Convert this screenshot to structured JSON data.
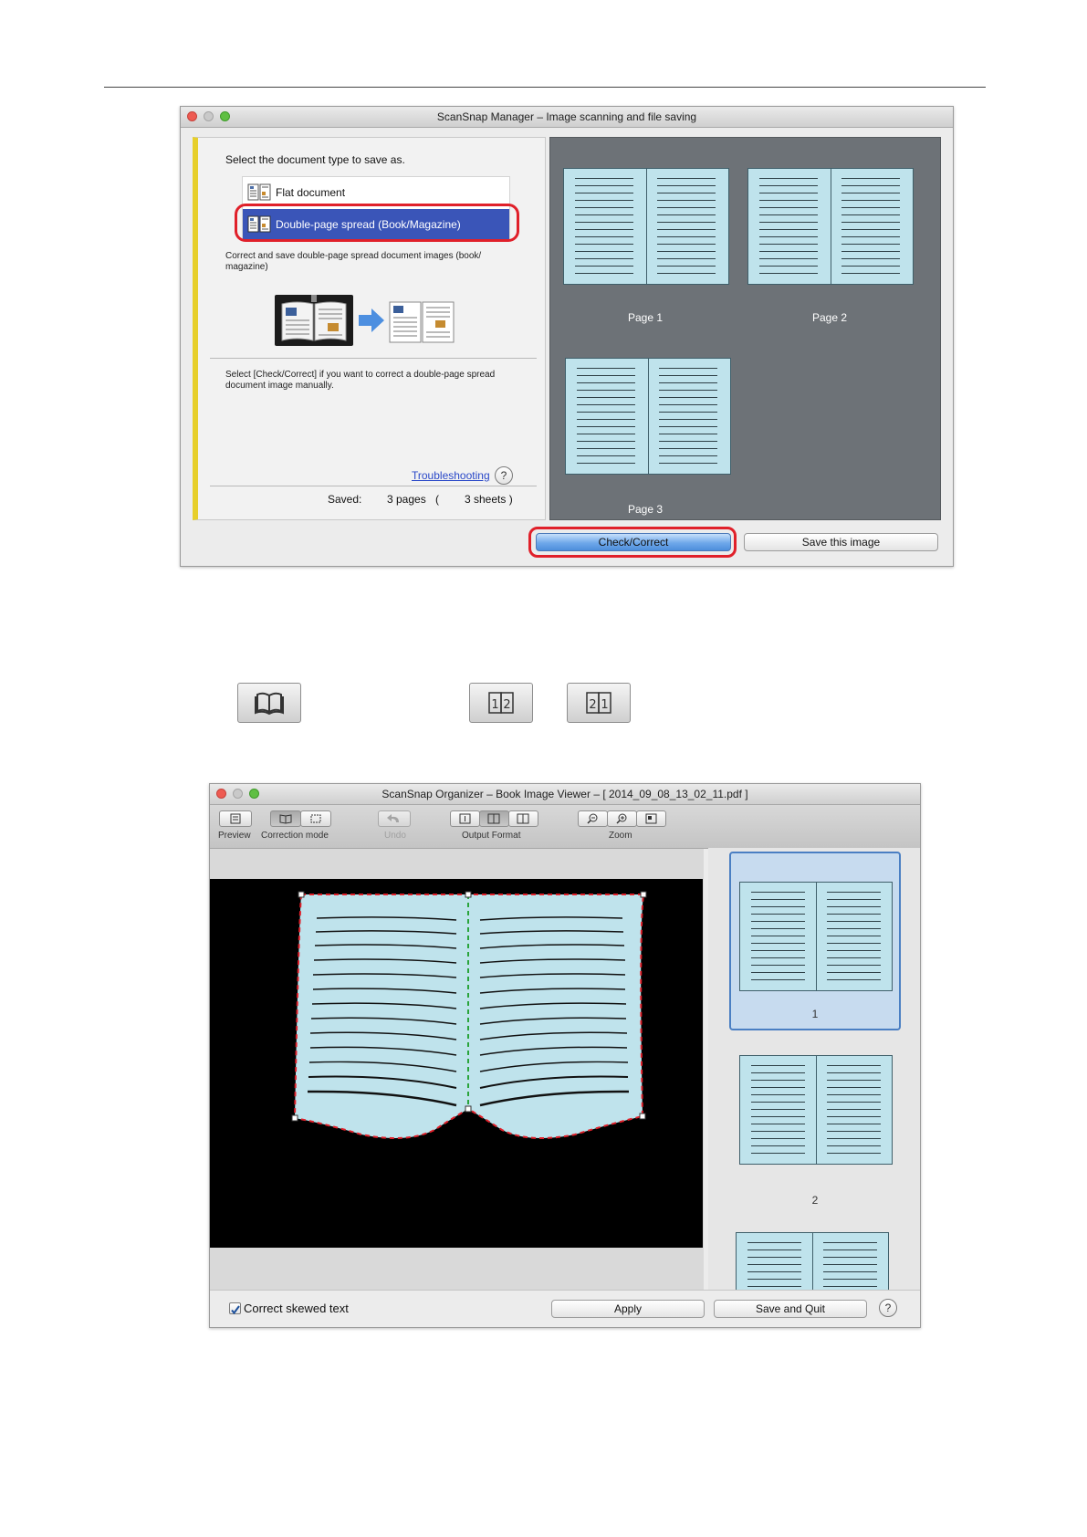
{
  "scanner_window": {
    "title": "ScanSnap Manager – Image scanning and file saving",
    "prompt": "Select the document type to save as.",
    "options": [
      "Flat document",
      "Double-page spread (Book/Magazine)"
    ],
    "option_description": "Correct and save double-page spread document images (book/ magazine)",
    "check_note": "Select [Check/Correct] if you want to correct a double-page spread document image manually.",
    "troubleshooting_link": "Troubleshooting",
    "help_glyph": "?",
    "saved_label": "Saved:",
    "saved_pages": "3 pages",
    "saved_open_paren": "(",
    "saved_sheets": "3 sheets )",
    "pages": [
      "Page 1",
      "Page 2",
      "Page 3"
    ],
    "check_correct_button": "Check/Correct",
    "save_image_button": "Save this image"
  },
  "viewer_window": {
    "title": "ScanSnap Organizer – Book Image Viewer – [ 2014_09_08_13_02_11.pdf ]",
    "toolbar_labels": {
      "preview": "Preview",
      "correction_mode": "Correction mode",
      "undo": "Undo",
      "output_format": "Output Format",
      "zoom": "Zoom"
    },
    "thumbnails": [
      "1",
      "2"
    ],
    "correct_skewed_text": "Correct skewed text",
    "apply_button": "Apply",
    "save_quit_button": "Save and Quit",
    "help_glyph": "?"
  },
  "colors": {
    "selection_blue": "#3a55b8",
    "highlight_red": "#e0202a",
    "page_blue": "#bfe3ec",
    "selected_thumb": "#c7dbef",
    "guide_green": "#2aa43b"
  }
}
